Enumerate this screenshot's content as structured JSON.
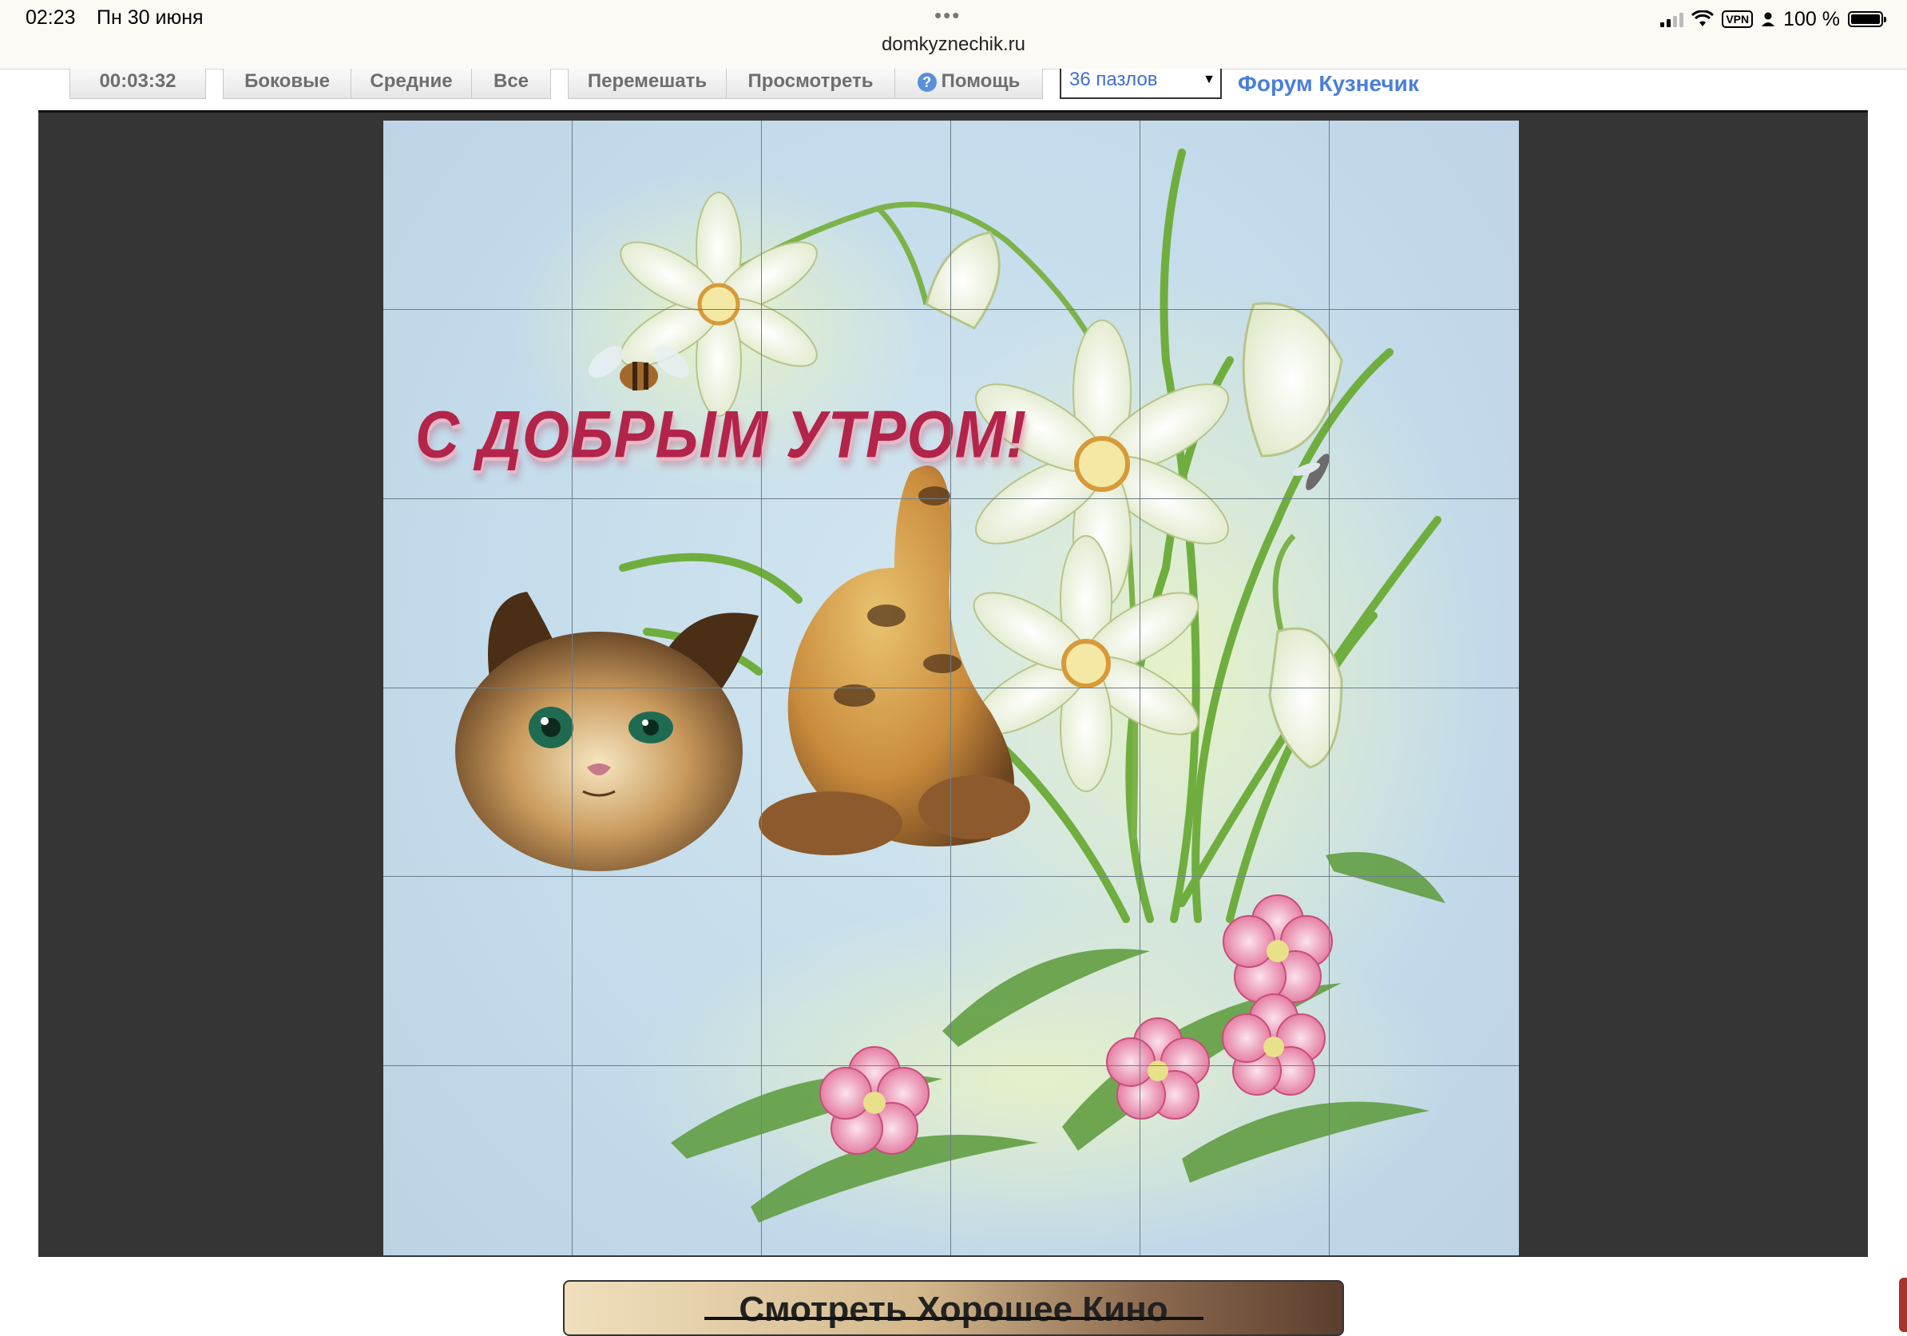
{
  "status_bar": {
    "time": "02:23",
    "date": "Пн 30 июня",
    "dots": "•••",
    "url": "domkyznechik.ru",
    "vpn": "VPN",
    "battery_percent": "100 %",
    "battery_level": 1.0,
    "icons": [
      "signal-icon",
      "wifi-icon",
      "vpn-icon",
      "person-icon",
      "battery-icon"
    ]
  },
  "toolbar": {
    "timer": "00:03:32",
    "btn_sides": "Боковые",
    "btn_middle": "Средние",
    "btn_all": "Все",
    "btn_shuffle": "Перемешать",
    "btn_view": "Просмотреть",
    "btn_help": "Помощь",
    "help_icon": "?",
    "select_value": "36 пазлов",
    "select_arrow": "▼",
    "forum_link": "Форум Кузнечик"
  },
  "puzzle": {
    "greeting": "С ДОБРЫМ УТРОМ!",
    "rows": 6,
    "cols": 6
  },
  "banner": {
    "text": "Смотреть Хорошее Кино"
  },
  "colors": {
    "game_bg": "#353535",
    "link": "#4a7fd8",
    "greeting": "#b3244a"
  }
}
